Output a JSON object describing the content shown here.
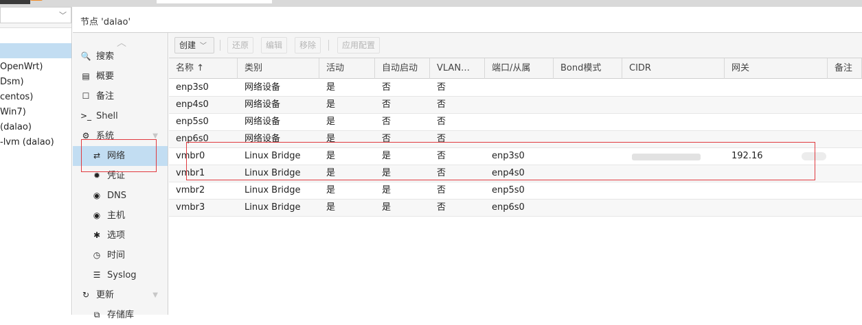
{
  "tree": {
    "rows": [
      "OpenWrt)",
      "Dsm)",
      "centos)",
      "Win7)",
      " (dalao)",
      "-lvm (dalao)"
    ]
  },
  "header": {
    "title": "节点 'dalao'"
  },
  "nav": {
    "items": [
      {
        "label": "搜索",
        "icon": "search-icon",
        "glyph": "🔍",
        "level": 0
      },
      {
        "label": "概要",
        "icon": "book-icon",
        "glyph": "▤",
        "level": 0
      },
      {
        "label": "备注",
        "icon": "note-icon",
        "glyph": "☐",
        "level": 0
      },
      {
        "label": "Shell",
        "icon": "terminal-icon",
        "glyph": ">_",
        "level": 0
      },
      {
        "label": "系统",
        "icon": "cogs-icon",
        "glyph": "⚙",
        "level": 0,
        "group": true
      },
      {
        "label": "网络",
        "icon": "exchange-icon",
        "glyph": "⇄",
        "level": 1,
        "selected": true
      },
      {
        "label": "凭证",
        "icon": "certificate-icon",
        "glyph": "✹",
        "level": 1
      },
      {
        "label": "DNS",
        "icon": "globe-icon",
        "glyph": "◉",
        "level": 1
      },
      {
        "label": "主机",
        "icon": "globe-icon",
        "glyph": "◉",
        "level": 1
      },
      {
        "label": "选项",
        "icon": "gear-icon",
        "glyph": "✱",
        "level": 1
      },
      {
        "label": "时间",
        "icon": "clock-icon",
        "glyph": "◷",
        "level": 1
      },
      {
        "label": "Syslog",
        "icon": "list-icon",
        "glyph": "☰",
        "level": 1
      },
      {
        "label": "更新",
        "icon": "refresh-icon",
        "glyph": "↻",
        "level": 0,
        "group": true
      },
      {
        "label": "存储库",
        "icon": "files-icon",
        "glyph": "⧉",
        "level": 1
      }
    ]
  },
  "toolbar": {
    "create": "创建",
    "revert": "还原",
    "edit": "编辑",
    "remove": "移除",
    "apply": "应用配置"
  },
  "grid": {
    "columns": [
      "名称 ↑",
      "类别",
      "活动",
      "自动启动",
      "VLAN…",
      "端口/从属",
      "Bond模式",
      "CIDR",
      "网关",
      "备注"
    ],
    "rows": [
      [
        "enp3s0",
        "网络设备",
        "是",
        "否",
        "否",
        "",
        "",
        "",
        "",
        ""
      ],
      [
        "enp4s0",
        "网络设备",
        "是",
        "否",
        "否",
        "",
        "",
        "",
        "",
        ""
      ],
      [
        "enp5s0",
        "网络设备",
        "是",
        "否",
        "否",
        "",
        "",
        "",
        "",
        ""
      ],
      [
        "enp6s0",
        "网络设备",
        "是",
        "否",
        "否",
        "",
        "",
        "",
        "",
        ""
      ],
      [
        "vmbr0",
        "Linux Bridge",
        "是",
        "是",
        "否",
        "enp3s0",
        "",
        "",
        "192.16",
        ""
      ],
      [
        "vmbr1",
        "Linux Bridge",
        "是",
        "是",
        "否",
        "enp4s0",
        "",
        "",
        "",
        ""
      ],
      [
        "vmbr2",
        "Linux Bridge",
        "是",
        "是",
        "否",
        "enp5s0",
        "",
        "",
        "",
        ""
      ],
      [
        "vmbr3",
        "Linux Bridge",
        "是",
        "是",
        "否",
        "enp6s0",
        "",
        "",
        "",
        ""
      ]
    ]
  },
  "colors": {
    "selection": "#c2ddf2",
    "highlight": "#e0393e",
    "accent": "#f08a24"
  }
}
